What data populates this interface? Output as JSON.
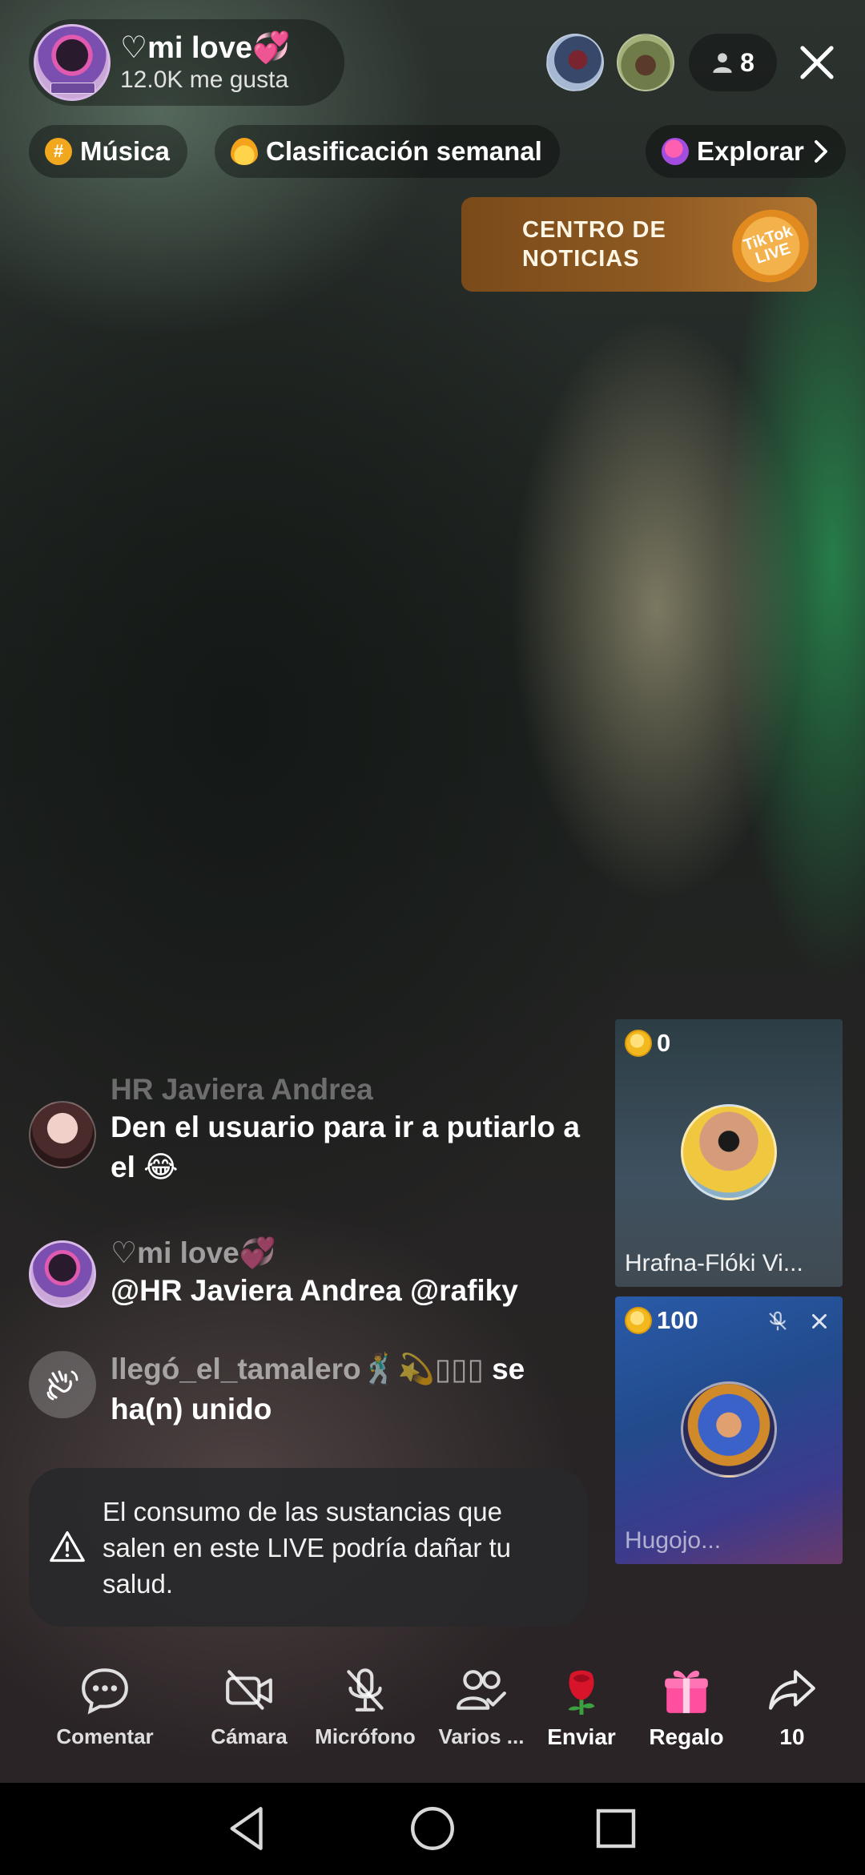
{
  "host": {
    "name": "♡mi love💞",
    "likes": "12.0K me gusta"
  },
  "viewers": {
    "count": "8"
  },
  "chips": [
    {
      "label": "Música",
      "icon": "music-hashtag-icon"
    },
    {
      "label": "Clasificación semanal",
      "icon": "flame-icon"
    },
    {
      "label": "Explorar",
      "icon": "planet-icon"
    }
  ],
  "news_banner": {
    "title": "CENTRO DE NOTICIAS",
    "logo_text": "TikTok LIVE"
  },
  "chat": [
    {
      "user": "HR Javiera Andrea",
      "message": "Den el usuario para ir a putiarlo a el 😂"
    },
    {
      "user": "♡mi love💞",
      "message": "@HR Javiera Andrea @rafiky"
    },
    {
      "user": "llegó_el_tamalero🕺💫▯▯▯",
      "message": "se ha(n) unido"
    }
  ],
  "warning": {
    "text": "El consumo de las sustancias que salen en este LIVE podría dañar tu salud."
  },
  "guests": [
    {
      "coins": "0",
      "name": "Hrafna-Flóki Vi..."
    },
    {
      "coins": "100",
      "name": "Hugojo..."
    }
  ],
  "toolbar": [
    {
      "label": "Comentar",
      "icon": "comment-icon"
    },
    {
      "label": "Cámara",
      "icon": "camera-off-icon"
    },
    {
      "label": "Micrófono",
      "icon": "mic-off-icon"
    },
    {
      "label": "Varios ...",
      "icon": "multi-guest-icon"
    },
    {
      "label": "Enviar",
      "icon": "rose-icon"
    },
    {
      "label": "Regalo",
      "icon": "gift-icon"
    },
    {
      "label": "10",
      "icon": "share-icon"
    }
  ],
  "colors": {
    "accent_gold": "#f2b81e",
    "banner_brown": "#8e5a22",
    "chip_bg": "rgba(0,0,0,0.35)"
  }
}
